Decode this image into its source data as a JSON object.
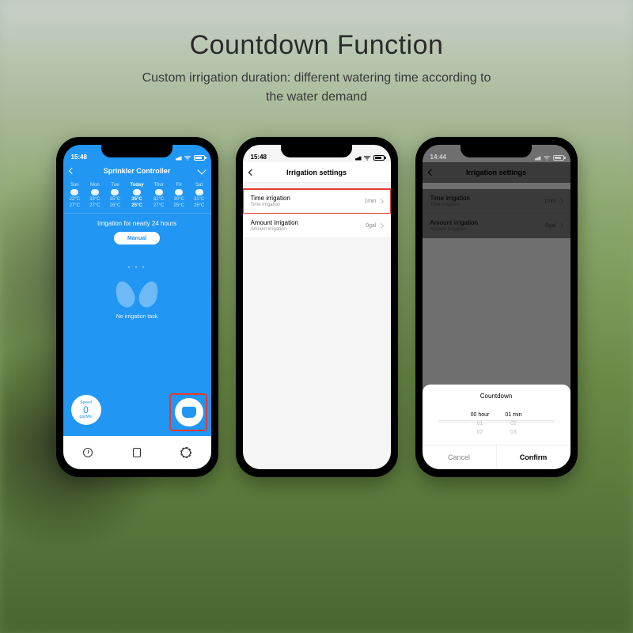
{
  "hero": {
    "title": "Countdown Function",
    "subtitle": "Custom irrigation duration: different watering time according to\nthe water demand"
  },
  "status": {
    "time": "15:48"
  },
  "status3": {
    "time": "14:44"
  },
  "phone1": {
    "title": "Sprinkler Controller",
    "days": [
      {
        "name": "Sun",
        "hi": "22°C",
        "lo": "27°C"
      },
      {
        "name": "Mon",
        "hi": "33°C",
        "lo": "27°C"
      },
      {
        "name": "Tue",
        "hi": "35°C",
        "lo": "26°C"
      },
      {
        "name": "Today",
        "hi": "35°C",
        "lo": "25°C"
      },
      {
        "name": "Thur",
        "hi": "32°C",
        "lo": "27°C"
      },
      {
        "name": "Fri",
        "hi": "30°C",
        "lo": "25°C"
      },
      {
        "name": "Sat",
        "hi": "31°C",
        "lo": "25°C"
      }
    ],
    "section": "Irrigation for nearly 24 hours",
    "manual": "Manual",
    "notask": "No irrigation task",
    "speed": {
      "label": "Speed",
      "value": "0",
      "unit": "gal/Min"
    }
  },
  "phone2": {
    "title": "Irrigation settings",
    "rows": [
      {
        "title": "Time irrigation",
        "sub": "Time irrigation",
        "val": "1min"
      },
      {
        "title": "Amount irrigation",
        "sub": "Amount irrigation",
        "val": "0gal"
      }
    ]
  },
  "phone3": {
    "title": "Irrigation settings",
    "rows": [
      {
        "title": "Time irrigation",
        "sub": "Time irrigation",
        "val": "1min"
      },
      {
        "title": "Amount irrigation",
        "sub": "Amount irrigation",
        "val": "0gal"
      }
    ],
    "sheet": {
      "title": "Countdown",
      "hourLabel": "hour",
      "minLabel": "min",
      "hours": [
        "00",
        "01",
        "02"
      ],
      "mins": [
        "01",
        "02",
        "03"
      ],
      "cancel": "Cancel",
      "confirm": "Confirm"
    }
  }
}
